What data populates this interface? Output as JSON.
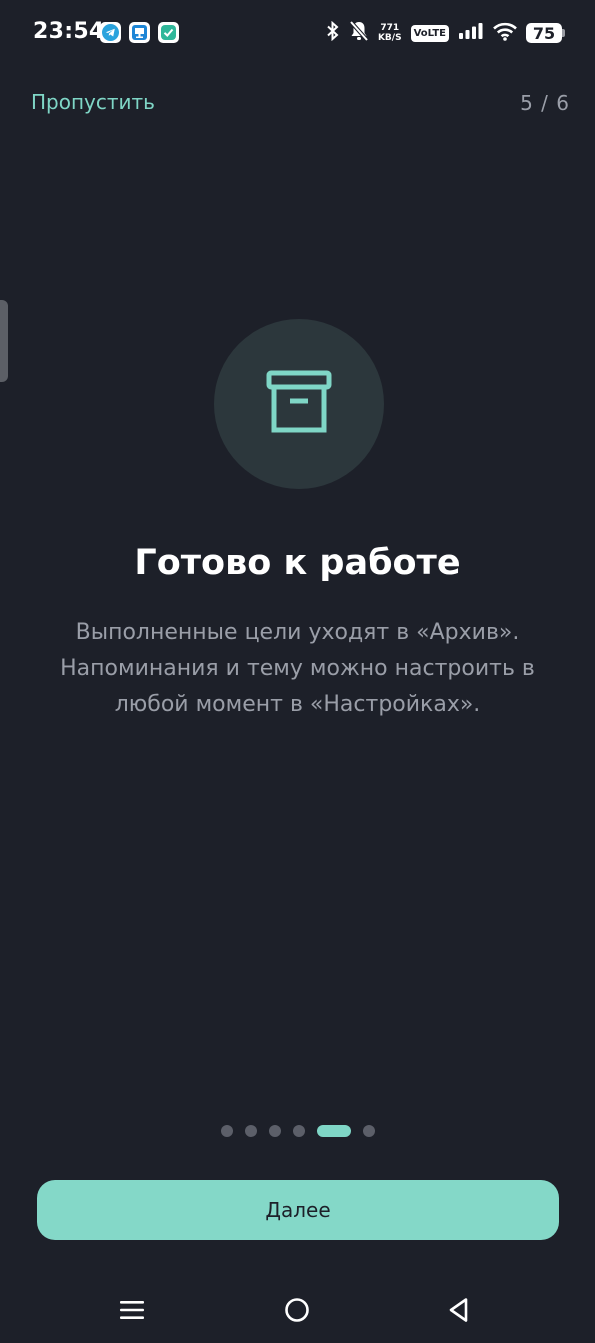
{
  "status_bar": {
    "time": "23:54",
    "notification_icons": [
      "telegram-icon",
      "desktop-app-icon",
      "check-app-icon"
    ],
    "net_speed_value": "771",
    "net_speed_unit": "KB/S",
    "volte_label": "VoLTE",
    "battery_level": "75",
    "system_icons": [
      "bluetooth-icon",
      "bell-muted-icon",
      "signal-icon",
      "wifi-icon"
    ]
  },
  "header": {
    "skip_label": "Пропустить",
    "page_counter": "5 / 6"
  },
  "hero": {
    "icon": "archive-box-icon",
    "title": "Готово к работе",
    "description": "Выполненные цели уходят в «Архив». Напоминания и тему можно настроить в любой момент в «Настройках»."
  },
  "pager": {
    "total": 6,
    "active_index": 4
  },
  "footer": {
    "next_label": "Далее"
  },
  "colors": {
    "background": "#1d2029",
    "accent": "#7fd6c6",
    "button": "#84d8c8",
    "muted_text": "#9a9ea8",
    "icon_circle": "#2c373c"
  },
  "nav_bar": {
    "buttons": [
      "menu-icon",
      "home-icon",
      "back-icon"
    ]
  }
}
